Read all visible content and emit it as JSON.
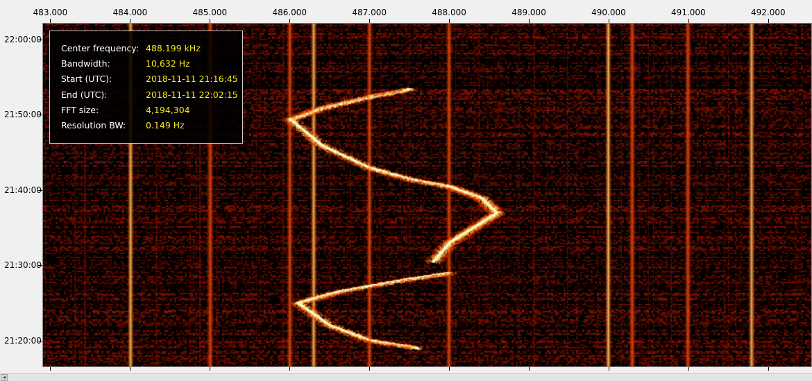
{
  "chart_data": {
    "type": "heatmap",
    "title": "",
    "xlabel": "",
    "ylabel": "",
    "x_ticks": [
      "483.000",
      "484.000",
      "485.000",
      "486.000",
      "487.000",
      "488.000",
      "489.000",
      "490.000",
      "491.000",
      "492.000"
    ],
    "y_ticks": [
      "22:00:00",
      "21:50:00",
      "21:40:00",
      "21:30:00",
      "21:20:00"
    ],
    "x_unit_values": [
      483,
      484,
      485,
      486,
      487,
      488,
      489,
      490,
      491,
      492
    ],
    "xlim": [
      482.9,
      492.55
    ],
    "y_tick_minutes": [
      1320,
      1310,
      1300,
      1290,
      1280
    ],
    "ylim_minutes": [
      1276.5,
      1322.2
    ],
    "colormap": [
      "#000000",
      "#5a0000",
      "#b01000",
      "#e83a00",
      "#ff8a10",
      "#ffd040",
      "#fffde0"
    ],
    "carriers_khz": [
      484.0,
      485.0,
      486.0,
      486.3,
      487.0,
      488.0,
      490.0,
      490.3,
      491.0,
      491.8
    ],
    "traces": [
      {
        "points_minutes_khz": [
          [
            1309.5,
            486.0
          ],
          [
            1311.0,
            486.4
          ],
          [
            1312.5,
            487.0
          ],
          [
            1313.5,
            487.5
          ]
        ]
      },
      {
        "points_minutes_khz": [
          [
            1309.5,
            486.0
          ],
          [
            1306.0,
            486.4
          ],
          [
            1303.0,
            487.0
          ],
          [
            1301.5,
            487.5
          ],
          [
            1300.5,
            488.0
          ]
        ]
      },
      {
        "points_minutes_khz": [
          [
            1300.5,
            488.0
          ],
          [
            1299.0,
            488.4
          ],
          [
            1297.0,
            488.6
          ],
          [
            1295.0,
            488.3
          ],
          [
            1293.0,
            488.0
          ],
          [
            1290.5,
            487.8
          ]
        ]
      },
      {
        "points_minutes_khz": [
          [
            1289.0,
            488.0
          ],
          [
            1288.0,
            487.4
          ],
          [
            1286.5,
            486.6
          ],
          [
            1285.0,
            486.1
          ]
        ]
      },
      {
        "points_minutes_khz": [
          [
            1285.0,
            486.1
          ],
          [
            1282.0,
            486.5
          ],
          [
            1280.0,
            487.0
          ],
          [
            1279.0,
            487.6
          ]
        ]
      }
    ]
  },
  "info": {
    "rows": [
      {
        "key": "Center frequency:",
        "value": "488.199 kHz"
      },
      {
        "key": "Bandwidth:",
        "value": "10,632 Hz"
      },
      {
        "key": "Start (UTC):",
        "value": "2018-11-11 21:16:45"
      },
      {
        "key": "End (UTC):",
        "value": "2018-11-11 22:02:15"
      },
      {
        "key": "FFT size:",
        "value": "4,194,304"
      },
      {
        "key": "Resolution BW:",
        "value": "0.149 Hz"
      }
    ]
  },
  "scrollbar": {
    "left_arrow_glyph": "◂"
  }
}
